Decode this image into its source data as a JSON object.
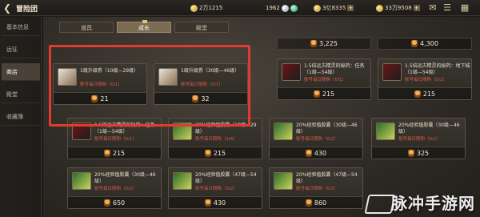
{
  "header": {
    "title": "冒险团",
    "currencies": [
      {
        "icon": "gold-coin-icon",
        "value": "2万1215"
      },
      {
        "icon": "silver-coin-icon",
        "value": "1962"
      },
      {
        "icon": "gold-coin-icon",
        "value": "3亿8335"
      },
      {
        "icon": "gold-coin-icon",
        "value": "33万9508"
      }
    ]
  },
  "sidebar": {
    "items": [
      {
        "label": "基本信息"
      },
      {
        "label": "远征"
      },
      {
        "label": "商店"
      },
      {
        "label": "殿堂"
      },
      {
        "label": "收藏簿"
      }
    ],
    "active_index": 2
  },
  "tabs": [
    {
      "label": "道具"
    },
    {
      "label": "成长"
    },
    {
      "label": "殿堂"
    }
  ],
  "top_prices": [
    "3,225",
    "4,300"
  ],
  "cards": [
    {
      "name": "1级升级券（10级—29级）",
      "limit": "账号每日限购（0/1）",
      "price": "21"
    },
    {
      "name": "1级升级券（30级—46级）",
      "limit": "账号每日限购（0/1）",
      "price": "32"
    },
    {
      "name": "1.5倍远古精灵的秘药：任务（1级—54级）",
      "limit": "账号每日限购（0/1）",
      "price": "215"
    },
    {
      "name": "1.5倍远古精灵的秘药：地下城（1级—54级）",
      "limit": "账号每日限购（0/1）",
      "price": "215"
    },
    {
      "name": "1.5倍远古精灵的秘药：任务（1级—54级）",
      "limit": "账号每日限购（0/1）",
      "price": "215"
    },
    {
      "name": "20%经验值胶囊（10级—29级）",
      "limit": "账号每日限购（1/6）",
      "price": "215"
    },
    {
      "name": "20%经验值胶囊（30级—46级）",
      "limit": "账号每日限购（0/2）",
      "price": "430"
    },
    {
      "name": "20%经验值胶囊（30级—46级）",
      "limit": "账号每日限购（0/2）",
      "price": "325"
    },
    {
      "name": "20%经验值胶囊（30级—46级）",
      "limit": "账号每日限购（0/2）",
      "price": "650"
    },
    {
      "name": "20%经验值胶囊（47级—54级）",
      "limit": "账号每日限购（0/2）",
      "price": "430"
    },
    {
      "name": "20%经验值胶囊（47级—54级）",
      "limit": "账号每日限购（0/2）",
      "price": "860"
    }
  ],
  "watermark": "脉冲手游网",
  "colors": {
    "highlight": "#e23b2e",
    "limit_text": "#d65a4a"
  }
}
